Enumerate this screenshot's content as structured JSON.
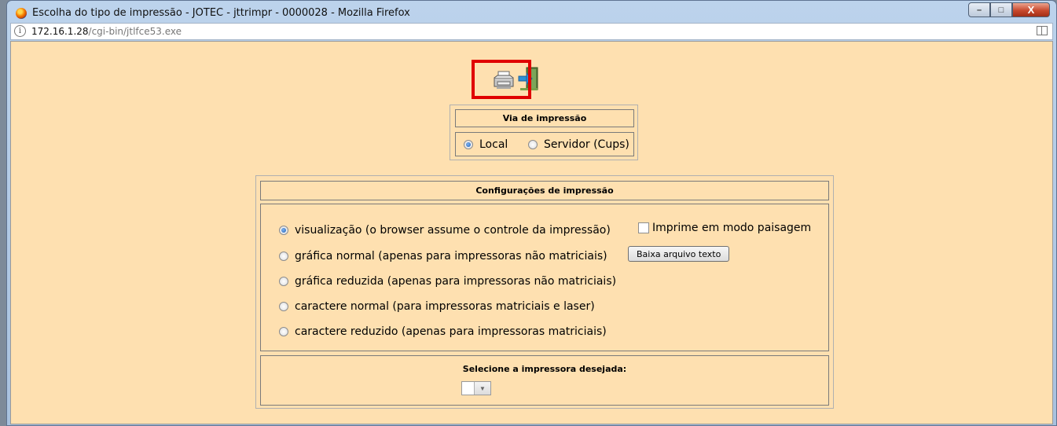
{
  "window": {
    "title": "Escolha do tipo de impressão - JOTEC - jttrimpr - 0000028 - Mozilla Firefox",
    "controls": {
      "minimize": "–",
      "maximize": "□",
      "close": "X"
    }
  },
  "address_bar": {
    "host": "172.16.1.28",
    "path": "/cgi-bin/jtlfce53.exe",
    "info_icon": "i"
  },
  "toolbar": {
    "icons": [
      "printer-icon",
      "exit-door-icon"
    ]
  },
  "via": {
    "title": "Via de impressão",
    "options": [
      {
        "label": "Local",
        "checked": true
      },
      {
        "label": "Servidor (Cups)",
        "checked": false
      }
    ]
  },
  "config": {
    "title": "Configurações de impressão",
    "options": [
      {
        "label": "visualização (o browser assume o controle da impressão)",
        "checked": true
      },
      {
        "label": "gráfica normal (apenas para impressoras não matriciais)",
        "checked": false
      },
      {
        "label": "gráfica reduzida (apenas para impressoras não matriciais)",
        "checked": false
      },
      {
        "label": "caractere normal (para impressoras matriciais e laser)",
        "checked": false
      },
      {
        "label": "caractere reduzido (apenas para impressoras matriciais)",
        "checked": false
      }
    ],
    "landscape_label": "Imprime em modo paisagem",
    "download_button": "Baixa arquivo texto"
  },
  "printer": {
    "title": "Selecione a impressora desejada:",
    "selected": ""
  },
  "colors": {
    "content_bg": "#fee0b0",
    "highlight": "#e00000"
  }
}
